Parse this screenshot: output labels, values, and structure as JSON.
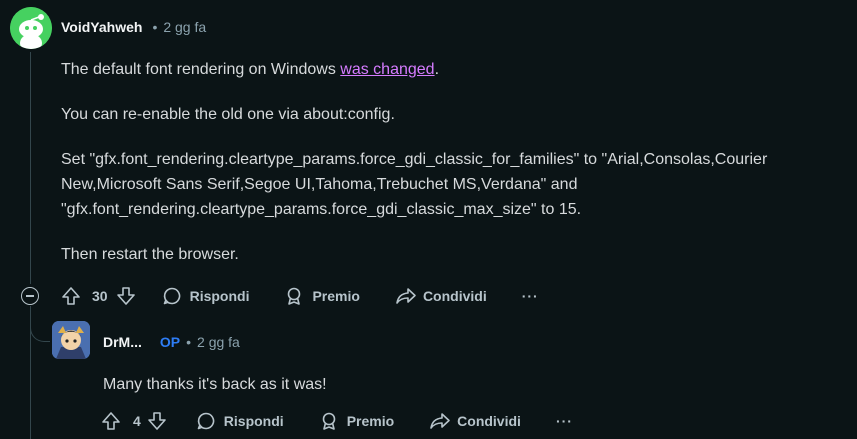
{
  "comment": {
    "author": "VoidYahweh",
    "separator": "•",
    "time": "2 gg fa",
    "paragraph1_text": "The default font rendering on Windows ",
    "paragraph1_link": "was changed",
    "paragraph1_end": ".",
    "paragraph2": "You can re-enable the old one via about:config.",
    "paragraph3_line1": "Set \"gfx.font_rendering.cleartype_params.force_gdi_classic_for_families\" to \"Arial,Consolas,Courier",
    "paragraph3_line2": "New,Microsoft Sans Serif,Segoe UI,Tahoma,Trebuchet MS,Verdana\" and",
    "paragraph3_line3": "\"gfx.font_rendering.cleartype_params.force_gdi_classic_max_size\" to 15.",
    "paragraph4": "Then restart the browser.",
    "votes": "30",
    "reply_label": "Rispondi",
    "award_label": "Premio",
    "share_label": "Condividi",
    "more_label": "···"
  },
  "reply": {
    "author": "DrM...",
    "op_badge": "OP",
    "separator": "•",
    "time": "2 gg fa",
    "text": "Many thanks it's back as it was!",
    "votes": "4",
    "reply_label": "Rispondi",
    "award_label": "Premio",
    "share_label": "Condividi",
    "more_label": "···"
  },
  "colors": {
    "background": "#0b1416",
    "link": "#d67cff",
    "op": "#2e7df6",
    "avatar_main": "#46d160"
  },
  "icons": [
    "upvote-icon",
    "downvote-icon",
    "comment-icon",
    "award-icon",
    "share-icon",
    "more-icon",
    "collapse-icon"
  ]
}
